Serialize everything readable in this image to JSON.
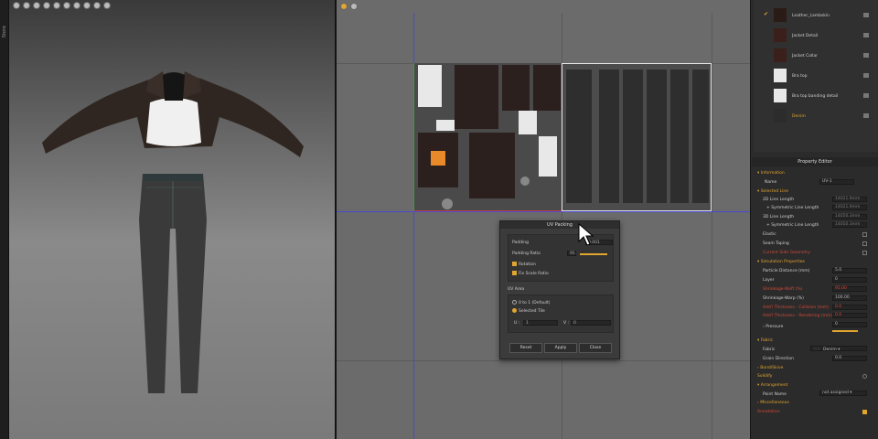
{
  "left_strip": {
    "label": "Store"
  },
  "dialog": {
    "title": "UV Packing",
    "padding_label": "Padding",
    "padding_value": "0.001",
    "padding_ratio_label": "Padding Ratio",
    "padding_ratio_value": "95",
    "rotation_label": "Rotation",
    "fix_scale_label": "Fix Scale Ratio",
    "uv_area_label": "UV Area",
    "option_0to1": "0 to 1 (Default)",
    "option_selected_tile": "Selected Tile",
    "u_label": "U :",
    "u_value": "1",
    "v_label": "V :",
    "v_value": "0",
    "reset": "Reset",
    "apply": "Apply",
    "close": "Close"
  },
  "fabrics": [
    {
      "name": "Leather_Lambskin",
      "color": "#2a1b17",
      "active": true
    },
    {
      "name": "Jacket Detail",
      "color": "#3a1f1a",
      "active": false
    },
    {
      "name": "Jacket Collar",
      "color": "#3a1f1a",
      "active": false
    },
    {
      "name": "Bra top",
      "color": "#e8e8e8",
      "active": false
    },
    {
      "name": "Bra top banding detail",
      "color": "#e8e8e8",
      "active": false
    },
    {
      "name": "Denim",
      "color": "#2c2c2c",
      "active": false
    }
  ],
  "property_editor": {
    "title": "Property Editor",
    "information": "Information",
    "name_label": "Name",
    "name_value": "UV-1",
    "selected_line": "Selected Line",
    "line_2d": "2D Line Length",
    "line_2d_value": "14021.9mm",
    "sym_line": "+ Symmetric Line Length",
    "sym_line_value": "14021.9mm",
    "line_3d": "3D Line Length",
    "line_3d_value": "14050.3mm",
    "sym_line_3d": "+ Symmetric Line Length",
    "sym_line_3d_value": "14050.3mm",
    "elastic": "Elastic",
    "seam_taping": "Seam Taping",
    "current_side": "Current Side Geometry",
    "simulation": "Simulation Properties",
    "particle_distance": "Particle Distance (mm)",
    "particle_distance_value": "5.0",
    "layer": "Layer",
    "layer_value": "0",
    "shrinkage_weft": "Shrinkage-Weft (%)",
    "shrinkage_weft_value": "95.00",
    "shrinkage_warp": "Shrinkage-Warp (%)",
    "shrinkage_warp_value": "100.00",
    "add_thick_collision": "Add'l Thickness - Collision (mm)",
    "add_thick_collision_value": "0.0",
    "add_thick_render": "Add'l Thickness - Rendering (mm)",
    "add_thick_render_value": "0.0",
    "pressure": "Pressure",
    "pressure_value": "0",
    "fabric_section": "Fabric",
    "fabric_label": "Fabric",
    "fabric_value": "Denim",
    "grain_label": "Grain Direction",
    "grain_value": "0.0",
    "bond_skive": "Bond/Skive",
    "solidify": "Solidify",
    "arrangement": "Arrangement",
    "point_name": "Point Name",
    "point_name_value": "not assigned",
    "miscellaneous": "Miscellaneous",
    "annotation": "Annotation"
  },
  "colors": {
    "accent": "#e1a530",
    "alert": "#d24a3a"
  }
}
